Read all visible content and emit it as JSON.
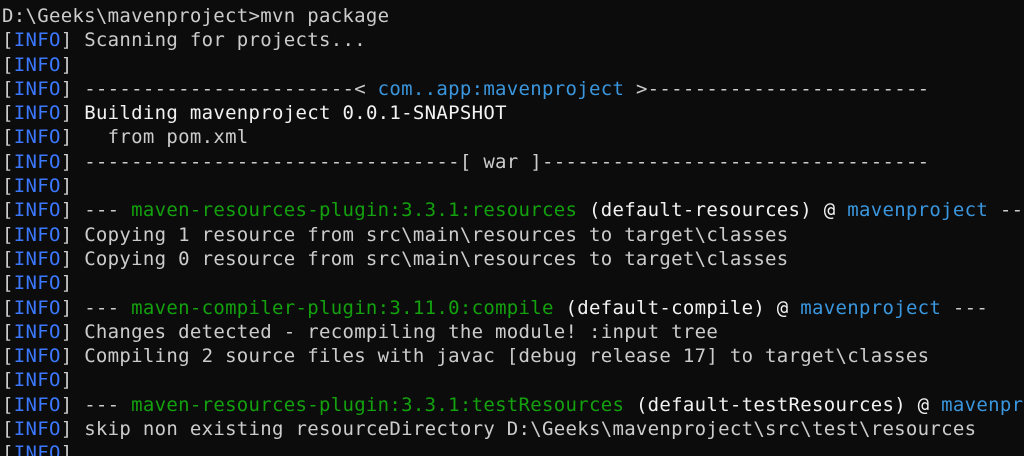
{
  "window": {
    "kind": "terminal",
    "colors": {
      "background": "#0c0c0c",
      "default_text": "#cccccc",
      "info_tag": "#3b78ff",
      "plugin_green": "#13a10e",
      "project_cyan": "#3a96dd",
      "bright_text": "#f2f2f2"
    }
  },
  "lines": [
    {
      "kind": "prompt",
      "segments": [
        {
          "text": "D:\\Geeks\\mavenproject>mvn package",
          "style": "default"
        }
      ]
    },
    {
      "kind": "log",
      "segments": [
        {
          "text": "[",
          "style": "default"
        },
        {
          "text": "INFO",
          "style": "info"
        },
        {
          "text": "] Scanning for projects...",
          "style": "default"
        }
      ]
    },
    {
      "kind": "log",
      "segments": [
        {
          "text": "[",
          "style": "default"
        },
        {
          "text": "INFO",
          "style": "info"
        },
        {
          "text": "]",
          "style": "default"
        }
      ]
    },
    {
      "kind": "log",
      "segments": [
        {
          "text": "[",
          "style": "default"
        },
        {
          "text": "INFO",
          "style": "info"
        },
        {
          "text": "] -----------------------< ",
          "style": "default"
        },
        {
          "text": "com..app:mavenproject",
          "style": "cyan"
        },
        {
          "text": " >------------------------",
          "style": "default"
        }
      ]
    },
    {
      "kind": "log",
      "segments": [
        {
          "text": "[",
          "style": "default"
        },
        {
          "text": "INFO",
          "style": "info"
        },
        {
          "text": "] ",
          "style": "default"
        },
        {
          "text": "Building mavenproject 0.0.1-SNAPSHOT",
          "style": "bold"
        }
      ]
    },
    {
      "kind": "log",
      "segments": [
        {
          "text": "[",
          "style": "default"
        },
        {
          "text": "INFO",
          "style": "info"
        },
        {
          "text": "]   from pom.xml",
          "style": "default"
        }
      ]
    },
    {
      "kind": "log",
      "segments": [
        {
          "text": "[",
          "style": "default"
        },
        {
          "text": "INFO",
          "style": "info"
        },
        {
          "text": "] --------------------------------[ war ]---------------------------------",
          "style": "default"
        }
      ]
    },
    {
      "kind": "log",
      "segments": [
        {
          "text": "[",
          "style": "default"
        },
        {
          "text": "INFO",
          "style": "info"
        },
        {
          "text": "]",
          "style": "default"
        }
      ]
    },
    {
      "kind": "log",
      "segments": [
        {
          "text": "[",
          "style": "default"
        },
        {
          "text": "INFO",
          "style": "info"
        },
        {
          "text": "] --- ",
          "style": "default"
        },
        {
          "text": "maven-resources-plugin:3.3.1:resources",
          "style": "green"
        },
        {
          "text": " (default-resources) @ ",
          "style": "bold"
        },
        {
          "text": "mavenproject",
          "style": "cyan"
        },
        {
          "text": " ---",
          "style": "default"
        }
      ]
    },
    {
      "kind": "log",
      "segments": [
        {
          "text": "[",
          "style": "default"
        },
        {
          "text": "INFO",
          "style": "info"
        },
        {
          "text": "] Copying 1 resource from src\\main\\resources to target\\classes",
          "style": "default"
        }
      ]
    },
    {
      "kind": "log",
      "segments": [
        {
          "text": "[",
          "style": "default"
        },
        {
          "text": "INFO",
          "style": "info"
        },
        {
          "text": "] Copying 0 resource from src\\main\\resources to target\\classes",
          "style": "default"
        }
      ]
    },
    {
      "kind": "log",
      "segments": [
        {
          "text": "[",
          "style": "default"
        },
        {
          "text": "INFO",
          "style": "info"
        },
        {
          "text": "]",
          "style": "default"
        }
      ]
    },
    {
      "kind": "log",
      "segments": [
        {
          "text": "[",
          "style": "default"
        },
        {
          "text": "INFO",
          "style": "info"
        },
        {
          "text": "] --- ",
          "style": "default"
        },
        {
          "text": "maven-compiler-plugin:3.11.0:compile",
          "style": "green"
        },
        {
          "text": " (default-compile) @ ",
          "style": "bold"
        },
        {
          "text": "mavenproject",
          "style": "cyan"
        },
        {
          "text": " ---",
          "style": "default"
        }
      ]
    },
    {
      "kind": "log",
      "segments": [
        {
          "text": "[",
          "style": "default"
        },
        {
          "text": "INFO",
          "style": "info"
        },
        {
          "text": "] Changes detected - recompiling the module! :input tree",
          "style": "default"
        }
      ]
    },
    {
      "kind": "log",
      "segments": [
        {
          "text": "[",
          "style": "default"
        },
        {
          "text": "INFO",
          "style": "info"
        },
        {
          "text": "] Compiling 2 source files with javac [debug release 17] to target\\classes",
          "style": "default"
        }
      ]
    },
    {
      "kind": "log",
      "segments": [
        {
          "text": "[",
          "style": "default"
        },
        {
          "text": "INFO",
          "style": "info"
        },
        {
          "text": "]",
          "style": "default"
        }
      ]
    },
    {
      "kind": "log",
      "segments": [
        {
          "text": "[",
          "style": "default"
        },
        {
          "text": "INFO",
          "style": "info"
        },
        {
          "text": "] --- ",
          "style": "default"
        },
        {
          "text": "maven-resources-plugin:3.3.1:testResources",
          "style": "green"
        },
        {
          "text": " (default-testResources) @ ",
          "style": "bold"
        },
        {
          "text": "mavenproject",
          "style": "cyan"
        },
        {
          "text": " ---",
          "style": "default"
        }
      ]
    },
    {
      "kind": "log",
      "segments": [
        {
          "text": "[",
          "style": "default"
        },
        {
          "text": "INFO",
          "style": "info"
        },
        {
          "text": "] skip non existing resourceDirectory D:\\Geeks\\mavenproject\\src\\test\\resources",
          "style": "default"
        }
      ]
    },
    {
      "kind": "log",
      "segments": [
        {
          "text": "[",
          "style": "default"
        },
        {
          "text": "INFO",
          "style": "info"
        },
        {
          "text": "]",
          "style": "default"
        }
      ]
    }
  ]
}
